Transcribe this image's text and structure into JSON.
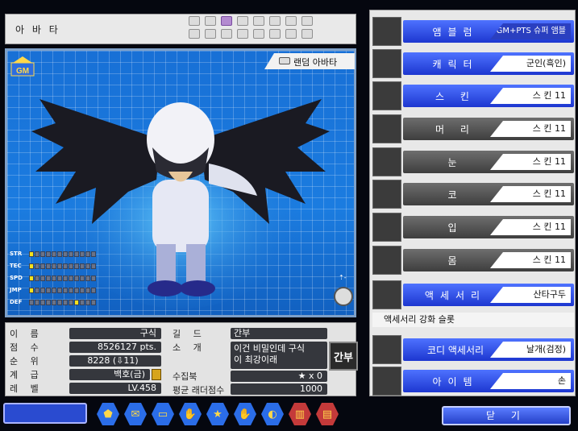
{
  "window": {
    "title": "아 바 타"
  },
  "slots": {
    "count": 16,
    "selected_index": 2
  },
  "preview": {
    "random_avatar_label": "랜덤 아바타",
    "stats": [
      {
        "name": "STR",
        "level": 0
      },
      {
        "name": "TEC",
        "level": 0
      },
      {
        "name": "SPD",
        "level": 0
      },
      {
        "name": "JMP",
        "level": 0
      },
      {
        "name": "DEF",
        "level": 8
      }
    ]
  },
  "info": {
    "name_label": "이 름",
    "name_value": "구식",
    "points_label": "점 수",
    "points_value": "8526127 pts.",
    "rank_label": "순 위",
    "rank_value": "8228 (⇩11)",
    "grade_label": "계 급",
    "grade_value": "백호(금)",
    "level_label": "레 벨",
    "level_value": "LV.458",
    "guild_label": "길 드",
    "guild_value": "간부",
    "intro_label": "소 개",
    "intro_line1": "이건 비밀인데 구식",
    "intro_line2": "이 최강이래",
    "collection_label": "수집북",
    "collection_value": "★ x 0",
    "ladder_label": "평균 래더점수",
    "ladder_value": "1000",
    "guild_emblem_text": "간부"
  },
  "bottom": {
    "close_label": "닫 기"
  },
  "panel": {
    "rows": [
      {
        "name": "앰블럼",
        "value": "GM+PTS 슈퍼 앰블럼"
      },
      {
        "name": "캐릭터",
        "value": "군인(흑인)"
      },
      {
        "name": "스 킨",
        "value": "스 킨 11"
      },
      {
        "name": "머 리",
        "value": "스 킨 11"
      },
      {
        "name": "눈",
        "value": "스 킨 11"
      },
      {
        "name": "코",
        "value": "스 킨 11"
      },
      {
        "name": "입",
        "value": "스 킨 11"
      },
      {
        "name": "몸",
        "value": "스 킨 11"
      },
      {
        "name": "액세서리",
        "value": "산타구두"
      },
      {
        "name": "코디 액세서리",
        "value": "날개(검정)"
      },
      {
        "name": "아이템",
        "value": "손"
      }
    ],
    "accessory_slot_label": "액세서리 강화 슬롯"
  },
  "colors": {
    "accent_blue": "#2a44d8",
    "slot_selected": "#b38ad0",
    "stat_filled": "#f4e21c"
  }
}
